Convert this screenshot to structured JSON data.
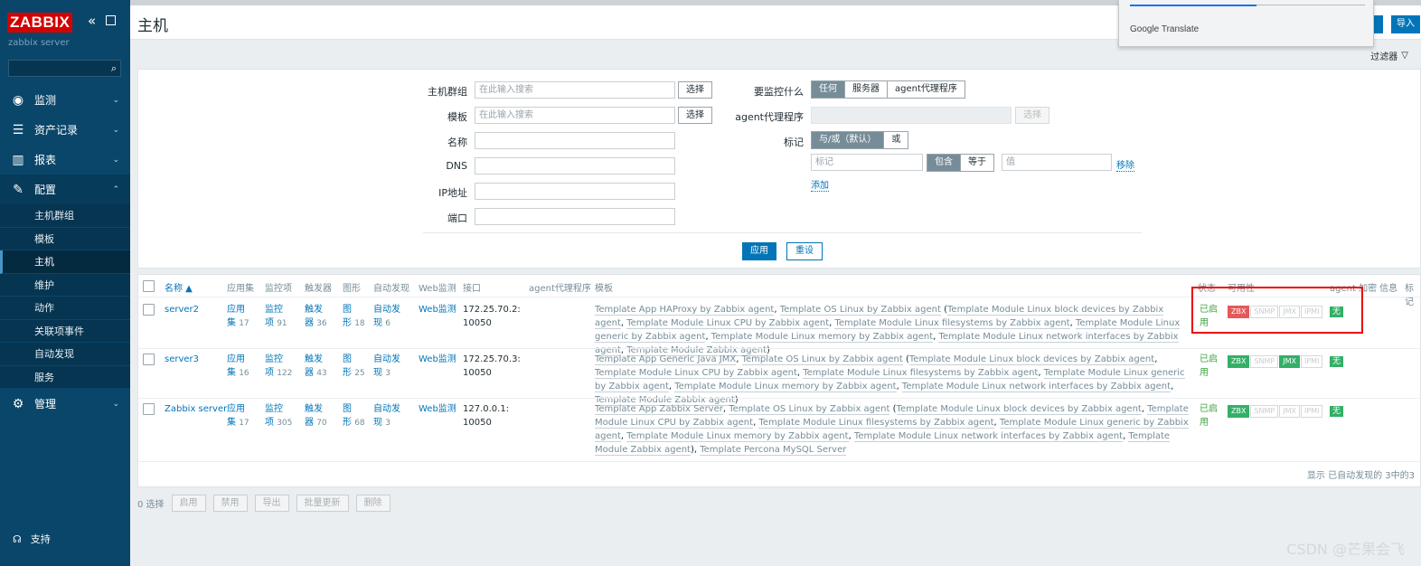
{
  "sidebar": {
    "logo": "ZABBIX",
    "collapse_icon": "«",
    "server_name": "zabbix server",
    "menu": [
      {
        "icon": "eye-icon",
        "label": "监测"
      },
      {
        "icon": "list-icon",
        "label": "资产记录"
      },
      {
        "icon": "chart-icon",
        "label": "报表"
      },
      {
        "icon": "wrench-icon",
        "label": "配置"
      },
      {
        "icon": "gear-icon",
        "label": "管理"
      }
    ],
    "submenu": [
      "主机群组",
      "模板",
      "主机",
      "维护",
      "动作",
      "关联项事件",
      "自动发现",
      "服务"
    ],
    "support": "支持"
  },
  "header": {
    "title": "主机",
    "import_label": "导入",
    "google_translate": "Google Translate",
    "filter_tab": "过滤器"
  },
  "filter": {
    "host_groups_label": "主机群组",
    "templates_label": "模板",
    "name_label": "名称",
    "dns_label": "DNS",
    "ip_label": "IP地址",
    "port_label": "端口",
    "search_placeholder": "在此输入搜索",
    "select_label": "选择",
    "monitored_by_label": "要监控什么",
    "monitored_by_options": [
      "任何",
      "服务器",
      "agent代理程序"
    ],
    "proxy_label": "agent代理程序",
    "tags_label": "标记",
    "tags_mode": [
      "与/或（默认）",
      "或"
    ],
    "tag_placeholder": "标记",
    "tag_ops": [
      "包含",
      "等于"
    ],
    "value_placeholder": "值",
    "remove_label": "移除",
    "add_label": "添加",
    "apply_label": "应用",
    "reset_label": "重设"
  },
  "table": {
    "headers": {
      "name": "名称 ▲",
      "apps": "应用集",
      "items": "监控项",
      "triggers": "触发器",
      "graphs": "图形",
      "discovery": "自动发现",
      "web": "Web监测",
      "interface": "接口",
      "proxy": "agent代理程序",
      "templates": "模板",
      "status": "状态",
      "availability": "可用性",
      "encryption": "agent 加密",
      "info": "信息",
      "tags": "标记"
    },
    "rows": [
      {
        "name": "server2",
        "apps_a": "应用",
        "apps_b": "集",
        "apps_count": "17",
        "items_a": "监控",
        "items_b": "项",
        "items_count": "91",
        "triggers_a": "触发",
        "triggers_b": "器",
        "triggers_count": "36",
        "graphs_a": "图",
        "graphs_b": "形",
        "graphs_count": "18",
        "disc_a": "自动发",
        "disc_b": "现",
        "disc_count": "6",
        "web": "Web监测",
        "iface_a": "172.25.70.2:",
        "iface_b": "10050",
        "templates_html_parts": [
          "Template App HAProxy by Zabbix agent",
          ", ",
          "Template OS Linux by Zabbix agent",
          " (",
          "Template Module Linux block devices by Zabbix agent",
          ", ",
          "Template Module Linux CPU by Zabbix agent",
          ", ",
          "Template Module Linux filesystems by Zabbix agent",
          ", ",
          "Template Module Linux generic by Zabbix agent",
          ", ",
          "Template Module Linux memory by Zabbix agent",
          ", ",
          "Template Module Linux network interfaces by Zabbix agent",
          ", ",
          "Template Module Zabbix agent",
          ")"
        ],
        "status_a": "已启",
        "status_b": "用",
        "avail": [
          {
            "t": "ZBX",
            "c": "red"
          },
          {
            "t": "SNMP",
            "c": ""
          },
          {
            "t": "JMX",
            "c": ""
          },
          {
            "t": "IPMI",
            "c": ""
          }
        ],
        "enc": "无"
      },
      {
        "name": "server3",
        "apps_a": "应用",
        "apps_b": "集",
        "apps_count": "16",
        "items_a": "监控",
        "items_b": "项",
        "items_count": "122",
        "triggers_a": "触发",
        "triggers_b": "器",
        "triggers_count": "43",
        "graphs_a": "图",
        "graphs_b": "形",
        "graphs_count": "25",
        "disc_a": "自动发",
        "disc_b": "现",
        "disc_count": "3",
        "web": "Web监测",
        "iface_a": "172.25.70.3:",
        "iface_b": "10050",
        "templates_html_parts": [
          "Template App Generic Java JMX",
          ", ",
          "Template OS Linux by Zabbix agent",
          " (",
          "Template Module Linux block devices by Zabbix agent",
          ", ",
          "Template Module Linux CPU by Zabbix agent",
          ", ",
          "Template Module Linux filesystems by Zabbix agent",
          ", ",
          "Template Module Linux generic by Zabbix agent",
          ", ",
          "Template Module Linux memory by Zabbix agent",
          ", ",
          "Template Module Linux network interfaces by Zabbix agent",
          ", ",
          "Template Module Zabbix agent",
          ")"
        ],
        "status_a": "已启",
        "status_b": "用",
        "avail": [
          {
            "t": "ZBX",
            "c": "grn"
          },
          {
            "t": "SNMP",
            "c": ""
          },
          {
            "t": "JMX",
            "c": "grn"
          },
          {
            "t": "IPMI",
            "c": ""
          }
        ],
        "enc": "无"
      },
      {
        "name": "Zabbix server",
        "apps_a": "应用",
        "apps_b": "集",
        "apps_count": "17",
        "items_a": "监控",
        "items_b": "项",
        "items_count": "305",
        "triggers_a": "触发",
        "triggers_b": "器",
        "triggers_count": "70",
        "graphs_a": "图",
        "graphs_b": "形",
        "graphs_count": "68",
        "disc_a": "自动发",
        "disc_b": "现",
        "disc_count": "3",
        "web": "Web监测",
        "iface_a": "127.0.0.1:",
        "iface_b": "10050",
        "templates_html_parts": [
          "Template App Zabbix Server",
          ", ",
          "Template OS Linux by Zabbix agent",
          " (",
          "Template Module Linux block devices by Zabbix agent",
          ", ",
          "Template Module Linux CPU by Zabbix agent",
          ", ",
          "Template Module Linux filesystems by Zabbix agent",
          ", ",
          "Template Module Linux generic by Zabbix agent",
          ", ",
          "Template Module Linux memory by Zabbix agent",
          ", ",
          "Template Module Linux network interfaces by Zabbix agent",
          ", ",
          "Template Module Zabbix agent",
          "), ",
          "Template Percona MySQL Server",
          ""
        ],
        "status_a": "已启",
        "status_b": "用",
        "avail": [
          {
            "t": "ZBX",
            "c": "grn"
          },
          {
            "t": "SNMP",
            "c": ""
          },
          {
            "t": "JMX",
            "c": ""
          },
          {
            "t": "IPMI",
            "c": ""
          }
        ],
        "enc": "无"
      }
    ],
    "footer": "显示 已自动发现的 3中的3"
  },
  "bulk": {
    "selected": "0 选择",
    "buttons": [
      "启用",
      "禁用",
      "导出",
      "批量更新",
      "删除"
    ]
  },
  "watermark": "CSDN @芒果会飞"
}
